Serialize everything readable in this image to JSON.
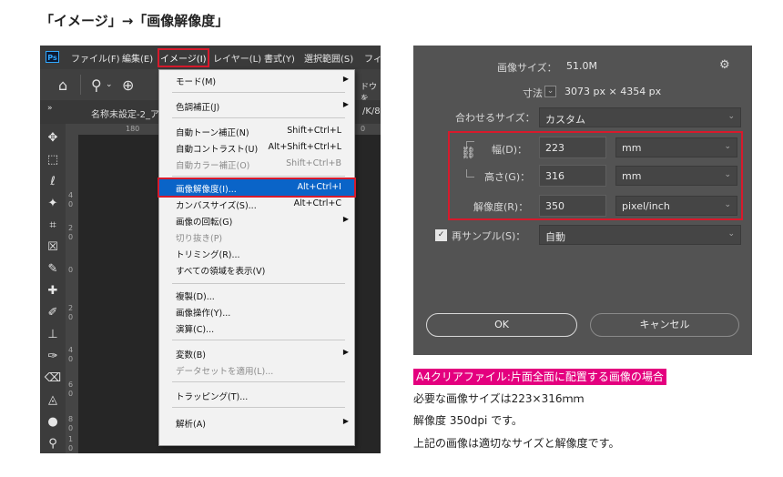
{
  "heading": "「イメージ」→「画像解像度」",
  "photoshop": {
    "app_logo": "Ps",
    "menubar": [
      "ファイル(F)",
      "編集(E)",
      "イメージ(I)",
      "レイヤー(L)",
      "書式(Y)",
      "選択範囲(S)",
      "フィ"
    ],
    "active_menu_index": 2,
    "options_bar_cutoff_text": "ドウを",
    "document_tab": "名称未設定-2_ア",
    "tab_right_cutoff": "/K/8)",
    "ruler_h_labels": [
      "180",
      "0"
    ],
    "ruler_v_labels": [
      "4",
      "0",
      "2",
      "0",
      "0",
      "2",
      "0",
      "4",
      "0",
      "6",
      "0",
      "8",
      "0",
      "1",
      "0"
    ],
    "image_menu": [
      {
        "label": "モード(M)",
        "shortcut": "",
        "submenu": true,
        "disabled": false,
        "highlighted": false
      },
      {
        "label": "色調補正(J)",
        "shortcut": "",
        "submenu": true,
        "disabled": false,
        "highlighted": false
      },
      {
        "label": "自動トーン補正(N)",
        "shortcut": "Shift+Ctrl+L",
        "submenu": false,
        "disabled": false,
        "highlighted": false
      },
      {
        "label": "自動コントラスト(U)",
        "shortcut": "Alt+Shift+Ctrl+L",
        "submenu": false,
        "disabled": false,
        "highlighted": false
      },
      {
        "label": "自動カラー補正(O)",
        "shortcut": "Shift+Ctrl+B",
        "submenu": false,
        "disabled": true,
        "highlighted": false
      },
      {
        "label": "画像解像度(I)...",
        "shortcut": "Alt+Ctrl+I",
        "submenu": false,
        "disabled": false,
        "highlighted": true
      },
      {
        "label": "カンバスサイズ(S)...",
        "shortcut": "Alt+Ctrl+C",
        "submenu": false,
        "disabled": false,
        "highlighted": false
      },
      {
        "label": "画像の回転(G)",
        "shortcut": "",
        "submenu": true,
        "disabled": false,
        "highlighted": false
      },
      {
        "label": "切り抜き(P)",
        "shortcut": "",
        "submenu": false,
        "disabled": true,
        "highlighted": false
      },
      {
        "label": "トリミング(R)...",
        "shortcut": "",
        "submenu": false,
        "disabled": false,
        "highlighted": false
      },
      {
        "label": "すべての領域を表示(V)",
        "shortcut": "",
        "submenu": false,
        "disabled": false,
        "highlighted": false
      },
      {
        "label": "複製(D)...",
        "shortcut": "",
        "submenu": false,
        "disabled": false,
        "highlighted": false
      },
      {
        "label": "画像操作(Y)...",
        "shortcut": "",
        "submenu": false,
        "disabled": false,
        "highlighted": false
      },
      {
        "label": "演算(C)...",
        "shortcut": "",
        "submenu": false,
        "disabled": false,
        "highlighted": false
      },
      {
        "label": "変数(B)",
        "shortcut": "",
        "submenu": true,
        "disabled": false,
        "highlighted": false
      },
      {
        "label": "データセットを適用(L)...",
        "shortcut": "",
        "submenu": false,
        "disabled": true,
        "highlighted": false
      },
      {
        "label": "トラッピング(T)...",
        "shortcut": "",
        "submenu": false,
        "disabled": false,
        "highlighted": false
      },
      {
        "label": "解析(A)",
        "shortcut": "",
        "submenu": true,
        "disabled": false,
        "highlighted": false
      }
    ]
  },
  "dialog": {
    "image_size_label": "画像サイズ：",
    "image_size_value": "51.0M",
    "dimensions_label": "寸法：",
    "dimensions_value": "3073 px × 4354 px",
    "fit_to_label": "合わせるサイズ：",
    "fit_to_value": "カスタム",
    "width_label": "幅(D)：",
    "width_value": "223",
    "width_unit": "mm",
    "height_label": "高さ(G)：",
    "height_value": "316",
    "height_unit": "mm",
    "resolution_label": "解像度(R)：",
    "resolution_value": "350",
    "resolution_unit": "pixel/inch",
    "resample_label": "再サンプル(S)：",
    "resample_checked": true,
    "resample_value": "自動",
    "ok_label": "OK",
    "cancel_label": "キャンセル"
  },
  "caption": {
    "title": "A4クリアファイル:片面全面に配置する画像の場合",
    "line1": "必要な画像サイズは223×316ｍｍ",
    "line2": "解像度 350dpi です。",
    "line3": "上記の画像は適切なサイズと解像度です。"
  },
  "colors": {
    "highlight_red": "#d71a2c",
    "menu_highlight_blue": "#0a64c8",
    "caption_magenta": "#e4007f"
  }
}
